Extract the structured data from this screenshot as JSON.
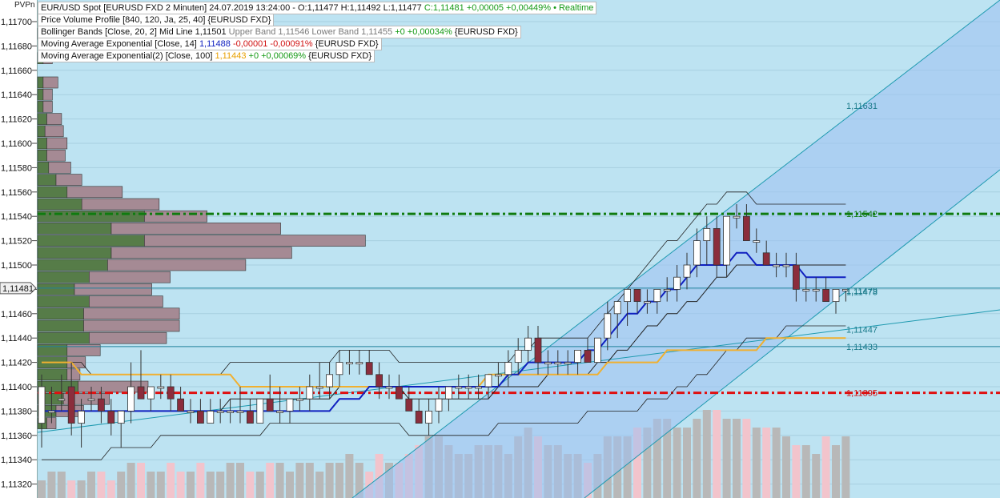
{
  "legend": {
    "symbol": {
      "title": "EUR/USD Spot [EURUSD FXD 2 Minuten] 24.07.2019 13:24:00 -",
      "ohl": "O:1,11477 H:1,11492 L:1,11477",
      "change": "C:1,11481 +0,00005 +0,00449% • Realtime"
    },
    "pvp": {
      "label": "Price Volume Profile [840, 120, Ja, 25, 40] {EURUSD FXD}"
    },
    "bb": {
      "name": "Bollinger Bands [Close, 20, 2]",
      "mid": "Mid Line 1,11501",
      "upper": "Upper Band 1,11546",
      "lower": "Lower Band 1,11455",
      "change": "+0 +0,00034%",
      "source": "{EURUSD FXD}"
    },
    "ema14": {
      "name": "Moving Average Exponential [Close, 14]",
      "value": "1,11488",
      "change": "-0,00001 -0,00091%",
      "source": "{EURUSD FXD}"
    },
    "ema100": {
      "name": "Moving Average Exponential(2) [Close, 100]",
      "value": "1,11443",
      "change": "+0 +0,00069%",
      "source": "{EURUSD FXD}"
    }
  },
  "axis": {
    "corner_label": "PVPn",
    "current_price_label": "1,11481",
    "tick_labels": [
      "1,11700",
      "1,11680",
      "1,11660",
      "1,11640",
      "1,11620",
      "1,11600",
      "1,11580",
      "1,11560",
      "1,11540",
      "1,11520",
      "1,11500",
      "1,11480",
      "1,11460",
      "1,11440",
      "1,11420",
      "1,11400",
      "1,11380",
      "1,11360",
      "1,11340",
      "1,11320"
    ]
  },
  "chart_data": {
    "type": "candlestick",
    "instrument": "EUR/USD Spot",
    "timeframe": "2 Minuten",
    "ylim": [
      1.1131,
      1.1171
    ],
    "yticks": [
      1.117,
      1.1168,
      1.1166,
      1.1164,
      1.1162,
      1.116,
      1.1158,
      1.1156,
      1.1154,
      1.1152,
      1.115,
      1.1148,
      1.1146,
      1.1144,
      1.1142,
      1.114,
      1.1138,
      1.1136,
      1.1134,
      1.1132
    ],
    "current_price": 1.11481,
    "candles": [
      {
        "o": 1.1137,
        "h": 1.1141,
        "l": 1.1135,
        "c": 1.114
      },
      {
        "o": 1.1138,
        "h": 1.114,
        "l": 1.1137,
        "c": 1.1138
      },
      {
        "o": 1.1139,
        "h": 1.1141,
        "l": 1.1138,
        "c": 1.1139
      },
      {
        "o": 1.114,
        "h": 1.1142,
        "l": 1.1136,
        "c": 1.1137
      },
      {
        "o": 1.1137,
        "h": 1.1139,
        "l": 1.1135,
        "c": 1.1138
      },
      {
        "o": 1.1139,
        "h": 1.114,
        "l": 1.1138,
        "c": 1.1139
      },
      {
        "o": 1.1139,
        "h": 1.114,
        "l": 1.1137,
        "c": 1.1138
      },
      {
        "o": 1.1138,
        "h": 1.1139,
        "l": 1.1136,
        "c": 1.1137
      },
      {
        "o": 1.1137,
        "h": 1.1138,
        "l": 1.1135,
        "c": 1.1138
      },
      {
        "o": 1.1138,
        "h": 1.1142,
        "l": 1.1137,
        "c": 1.114
      },
      {
        "o": 1.114,
        "h": 1.1143,
        "l": 1.1139,
        "c": 1.1139
      },
      {
        "o": 1.1139,
        "h": 1.114,
        "l": 1.1138,
        "c": 1.114
      },
      {
        "o": 1.114,
        "h": 1.1141,
        "l": 1.1139,
        "c": 1.114
      },
      {
        "o": 1.114,
        "h": 1.1141,
        "l": 1.1138,
        "c": 1.1139
      },
      {
        "o": 1.1139,
        "h": 1.114,
        "l": 1.1138,
        "c": 1.1138
      },
      {
        "o": 1.1138,
        "h": 1.1139,
        "l": 1.1137,
        "c": 1.1138
      },
      {
        "o": 1.1138,
        "h": 1.1139,
        "l": 1.1137,
        "c": 1.1137
      },
      {
        "o": 1.1137,
        "h": 1.1139,
        "l": 1.1137,
        "c": 1.1138
      },
      {
        "o": 1.1138,
        "h": 1.1139,
        "l": 1.1137,
        "c": 1.1138
      },
      {
        "o": 1.1138,
        "h": 1.1139,
        "l": 1.1137,
        "c": 1.1138
      },
      {
        "o": 1.1138,
        "h": 1.114,
        "l": 1.1137,
        "c": 1.1138
      },
      {
        "o": 1.1138,
        "h": 1.1139,
        "l": 1.1137,
        "c": 1.1137
      },
      {
        "o": 1.1137,
        "h": 1.1139,
        "l": 1.1137,
        "c": 1.1139
      },
      {
        "o": 1.1139,
        "h": 1.1141,
        "l": 1.1138,
        "c": 1.1138
      },
      {
        "o": 1.1138,
        "h": 1.114,
        "l": 1.1137,
        "c": 1.1138
      },
      {
        "o": 1.1138,
        "h": 1.1139,
        "l": 1.1137,
        "c": 1.1139
      },
      {
        "o": 1.1139,
        "h": 1.114,
        "l": 1.1138,
        "c": 1.1139
      },
      {
        "o": 1.1139,
        "h": 1.1141,
        "l": 1.1138,
        "c": 1.114
      },
      {
        "o": 1.114,
        "h": 1.1142,
        "l": 1.1139,
        "c": 1.114
      },
      {
        "o": 1.114,
        "h": 1.1142,
        "l": 1.1139,
        "c": 1.1141
      },
      {
        "o": 1.1141,
        "h": 1.1143,
        "l": 1.114,
        "c": 1.1142
      },
      {
        "o": 1.1142,
        "h": 1.1143,
        "l": 1.1141,
        "c": 1.1142
      },
      {
        "o": 1.1142,
        "h": 1.1143,
        "l": 1.1141,
        "c": 1.1142
      },
      {
        "o": 1.1142,
        "h": 1.1143,
        "l": 1.1141,
        "c": 1.1141
      },
      {
        "o": 1.1141,
        "h": 1.1142,
        "l": 1.1139,
        "c": 1.114
      },
      {
        "o": 1.114,
        "h": 1.1141,
        "l": 1.1139,
        "c": 1.114
      },
      {
        "o": 1.114,
        "h": 1.1141,
        "l": 1.1139,
        "c": 1.1139
      },
      {
        "o": 1.1139,
        "h": 1.114,
        "l": 1.1138,
        "c": 1.1138
      },
      {
        "o": 1.1138,
        "h": 1.1139,
        "l": 1.1137,
        "c": 1.1137
      },
      {
        "o": 1.1137,
        "h": 1.1139,
        "l": 1.1136,
        "c": 1.1138
      },
      {
        "o": 1.1138,
        "h": 1.114,
        "l": 1.1137,
        "c": 1.1139
      },
      {
        "o": 1.1139,
        "h": 1.114,
        "l": 1.1138,
        "c": 1.114
      },
      {
        "o": 1.114,
        "h": 1.1141,
        "l": 1.1139,
        "c": 1.114
      },
      {
        "o": 1.114,
        "h": 1.1141,
        "l": 1.1139,
        "c": 1.114
      },
      {
        "o": 1.114,
        "h": 1.1141,
        "l": 1.1139,
        "c": 1.114
      },
      {
        "o": 1.114,
        "h": 1.1141,
        "l": 1.1139,
        "c": 1.1141
      },
      {
        "o": 1.1141,
        "h": 1.1142,
        "l": 1.114,
        "c": 1.1141
      },
      {
        "o": 1.1141,
        "h": 1.1143,
        "l": 1.114,
        "c": 1.1142
      },
      {
        "o": 1.1142,
        "h": 1.1144,
        "l": 1.1141,
        "c": 1.1143
      },
      {
        "o": 1.1143,
        "h": 1.1145,
        "l": 1.1142,
        "c": 1.1144
      },
      {
        "o": 1.1144,
        "h": 1.1145,
        "l": 1.1141,
        "c": 1.1142
      },
      {
        "o": 1.1142,
        "h": 1.1143,
        "l": 1.1141,
        "c": 1.1142
      },
      {
        "o": 1.1142,
        "h": 1.1143,
        "l": 1.1141,
        "c": 1.1142
      },
      {
        "o": 1.1142,
        "h": 1.1143,
        "l": 1.1141,
        "c": 1.1142
      },
      {
        "o": 1.1142,
        "h": 1.1143,
        "l": 1.1141,
        "c": 1.1143
      },
      {
        "o": 1.1143,
        "h": 1.1144,
        "l": 1.1142,
        "c": 1.1142
      },
      {
        "o": 1.1142,
        "h": 1.1144,
        "l": 1.1142,
        "c": 1.1144
      },
      {
        "o": 1.1144,
        "h": 1.1147,
        "l": 1.1143,
        "c": 1.1146
      },
      {
        "o": 1.1146,
        "h": 1.1147,
        "l": 1.1144,
        "c": 1.1147
      },
      {
        "o": 1.1147,
        "h": 1.1148,
        "l": 1.1145,
        "c": 1.1148
      },
      {
        "o": 1.1148,
        "h": 1.1148,
        "l": 1.1146,
        "c": 1.1147
      },
      {
        "o": 1.1147,
        "h": 1.1148,
        "l": 1.1146,
        "c": 1.1147
      },
      {
        "o": 1.1147,
        "h": 1.1148,
        "l": 1.1146,
        "c": 1.1148
      },
      {
        "o": 1.1148,
        "h": 1.1149,
        "l": 1.1147,
        "c": 1.1148
      },
      {
        "o": 1.1148,
        "h": 1.115,
        "l": 1.1147,
        "c": 1.1149
      },
      {
        "o": 1.1149,
        "h": 1.1151,
        "l": 1.1148,
        "c": 1.115
      },
      {
        "o": 1.115,
        "h": 1.1153,
        "l": 1.1149,
        "c": 1.1152
      },
      {
        "o": 1.1152,
        "h": 1.1154,
        "l": 1.115,
        "c": 1.1153
      },
      {
        "o": 1.1153,
        "h": 1.1154,
        "l": 1.1149,
        "c": 1.115
      },
      {
        "o": 1.115,
        "h": 1.1154,
        "l": 1.1149,
        "c": 1.1154
      },
      {
        "o": 1.1154,
        "h": 1.1155,
        "l": 1.1153,
        "c": 1.1154
      },
      {
        "o": 1.1154,
        "h": 1.1155,
        "l": 1.1152,
        "c": 1.1152
      },
      {
        "o": 1.1152,
        "h": 1.1153,
        "l": 1.1151,
        "c": 1.1152
      },
      {
        "o": 1.1151,
        "h": 1.1152,
        "l": 1.115,
        "c": 1.115
      },
      {
        "o": 1.115,
        "h": 1.1151,
        "l": 1.1149,
        "c": 1.115
      },
      {
        "o": 1.115,
        "h": 1.1151,
        "l": 1.1149,
        "c": 1.115
      },
      {
        "o": 1.115,
        "h": 1.1151,
        "l": 1.1147,
        "c": 1.1148
      },
      {
        "o": 1.1148,
        "h": 1.1149,
        "l": 1.1147,
        "c": 1.1148
      },
      {
        "o": 1.1148,
        "h": 1.1149,
        "l": 1.1147,
        "c": 1.1148
      },
      {
        "o": 1.1148,
        "h": 1.1149,
        "l": 1.1147,
        "c": 1.1147
      },
      {
        "o": 1.1147,
        "h": 1.1148,
        "l": 1.1146,
        "c": 1.1148
      },
      {
        "o": 1.1148,
        "h": 1.1148,
        "l": 1.1147,
        "c": 1.1148
      }
    ],
    "ema14": [
      1.1138,
      1.1138,
      1.1138,
      1.1138,
      1.1138,
      1.1138,
      1.1138,
      1.1138,
      1.1138,
      1.1138,
      1.1138,
      1.1138,
      1.1138,
      1.1138,
      1.1138,
      1.1138,
      1.1138,
      1.1138,
      1.1138,
      1.1138,
      1.1138,
      1.1138,
      1.1138,
      1.1138,
      1.1138,
      1.1138,
      1.1138,
      1.1138,
      1.1138,
      1.1138,
      1.1139,
      1.1139,
      1.1139,
      1.114,
      1.114,
      1.114,
      1.114,
      1.114,
      1.114,
      1.114,
      1.114,
      1.114,
      1.114,
      1.114,
      1.114,
      1.114,
      1.114,
      1.1141,
      1.1141,
      1.1142,
      1.1142,
      1.1142,
      1.1142,
      1.1142,
      1.1142,
      1.1143,
      1.1143,
      1.1144,
      1.1145,
      1.1146,
      1.1146,
      1.1147,
      1.1147,
      1.1148,
      1.1148,
      1.1149,
      1.115,
      1.115,
      1.115,
      1.115,
      1.1151,
      1.1151,
      1.115,
      1.115,
      1.115,
      1.115,
      1.115,
      1.1149,
      1.1149,
      1.1149,
      1.1149,
      1.1149
    ],
    "ema100": [
      1.1142,
      1.1142,
      1.1142,
      1.1142,
      1.1141,
      1.1141,
      1.1141,
      1.1141,
      1.1141,
      1.1141,
      1.1141,
      1.1141,
      1.1141,
      1.1141,
      1.1141,
      1.1141,
      1.1141,
      1.1141,
      1.1141,
      1.1141,
      1.114,
      1.114,
      1.114,
      1.114,
      1.114,
      1.114,
      1.114,
      1.114,
      1.114,
      1.114,
      1.114,
      1.114,
      1.114,
      1.114,
      1.114,
      1.114,
      1.114,
      1.114,
      1.114,
      1.114,
      1.114,
      1.114,
      1.114,
      1.114,
      1.114,
      1.1141,
      1.1141,
      1.1141,
      1.1141,
      1.1141,
      1.1141,
      1.1141,
      1.1141,
      1.1141,
      1.1141,
      1.1141,
      1.1141,
      1.1142,
      1.1142,
      1.1142,
      1.1142,
      1.1142,
      1.1142,
      1.1143,
      1.1143,
      1.1143,
      1.1143,
      1.1143,
      1.1143,
      1.1143,
      1.1143,
      1.1143,
      1.1143,
      1.1144,
      1.1144,
      1.1144,
      1.1144,
      1.1144,
      1.1144,
      1.1144,
      1.1144,
      1.1144
    ],
    "bollinger_upper": [
      1.1142,
      1.1142,
      1.1142,
      1.1142,
      1.1142,
      1.1141,
      1.1141,
      1.1141,
      1.1141,
      1.1141,
      1.1141,
      1.1141,
      1.1141,
      1.1141,
      1.1141,
      1.1141,
      1.1141,
      1.1141,
      1.1141,
      1.1142,
      1.1142,
      1.1142,
      1.1142,
      1.1142,
      1.1142,
      1.1142,
      1.1142,
      1.1142,
      1.1142,
      1.1142,
      1.1143,
      1.1143,
      1.1143,
      1.1143,
      1.1143,
      1.1143,
      1.1142,
      1.1142,
      1.1142,
      1.1142,
      1.1142,
      1.1142,
      1.1142,
      1.1142,
      1.1142,
      1.1142,
      1.1142,
      1.1142,
      1.1143,
      1.1143,
      1.1144,
      1.1144,
      1.1144,
      1.1144,
      1.1144,
      1.1144,
      1.1145,
      1.1146,
      1.1147,
      1.1148,
      1.1149,
      1.115,
      1.1151,
      1.1152,
      1.1152,
      1.1153,
      1.1154,
      1.1155,
      1.1155,
      1.1156,
      1.1156,
      1.1156,
      1.1155,
      1.1155,
      1.1155,
      1.1155,
      1.1155,
      1.1155,
      1.1155,
      1.1155,
      1.1155,
      1.1155
    ],
    "bollinger_lower": [
      1.1134,
      1.1134,
      1.1134,
      1.1134,
      1.1134,
      1.1134,
      1.1134,
      1.1135,
      1.1135,
      1.1135,
      1.1135,
      1.1135,
      1.1136,
      1.1136,
      1.1136,
      1.1136,
      1.1136,
      1.1136,
      1.1136,
      1.1136,
      1.1136,
      1.1136,
      1.1136,
      1.1137,
      1.1137,
      1.1137,
      1.1137,
      1.1137,
      1.1137,
      1.1137,
      1.1137,
      1.1137,
      1.1137,
      1.1137,
      1.1137,
      1.1137,
      1.1137,
      1.1136,
      1.1136,
      1.1136,
      1.1136,
      1.1136,
      1.1136,
      1.1136,
      1.1136,
      1.1136,
      1.1137,
      1.1137,
      1.1137,
      1.1137,
      1.1137,
      1.1137,
      1.1137,
      1.1137,
      1.1137,
      1.1138,
      1.1138,
      1.1138,
      1.1138,
      1.1138,
      1.1138,
      1.1139,
      1.1139,
      1.1139,
      1.114,
      1.114,
      1.1141,
      1.1141,
      1.1142,
      1.1143,
      1.1143,
      1.1144,
      1.1144,
      1.1144,
      1.1144,
      1.1145,
      1.1145,
      1.1145,
      1.1145,
      1.1145,
      1.1145,
      1.1145
    ],
    "bollinger_mid": [
      1.1138,
      1.1138,
      1.1138,
      1.1138,
      1.1138,
      1.1138,
      1.1138,
      1.1138,
      1.1138,
      1.1138,
      1.1138,
      1.1138,
      1.1138,
      1.1138,
      1.1138,
      1.1138,
      1.1138,
      1.1138,
      1.1138,
      1.1139,
      1.1139,
      1.1139,
      1.1139,
      1.1139,
      1.1139,
      1.1139,
      1.1139,
      1.1139,
      1.1139,
      1.1139,
      1.114,
      1.114,
      1.114,
      1.114,
      1.114,
      1.114,
      1.114,
      1.1139,
      1.1139,
      1.1139,
      1.1139,
      1.1139,
      1.1139,
      1.1139,
      1.1139,
      1.1139,
      1.114,
      1.114,
      1.114,
      1.114,
      1.114,
      1.1141,
      1.1141,
      1.1141,
      1.1141,
      1.1141,
      1.1142,
      1.1142,
      1.1143,
      1.1143,
      1.1144,
      1.1145,
      1.1145,
      1.1146,
      1.1146,
      1.1147,
      1.1147,
      1.1148,
      1.1149,
      1.1149,
      1.115,
      1.115,
      1.115,
      1.115,
      1.115,
      1.115,
      1.115,
      1.115,
      1.115,
      1.115,
      1.115,
      1.115
    ],
    "volume_profile": [
      {
        "price": 1.1169,
        "up": 2,
        "down": 6
      },
      {
        "price": 1.1167,
        "up": 3,
        "down": 5
      },
      {
        "price": 1.1165,
        "up": 3,
        "down": 8
      },
      {
        "price": 1.1164,
        "up": 3,
        "down": 5
      },
      {
        "price": 1.1163,
        "up": 3,
        "down": 5
      },
      {
        "price": 1.1162,
        "up": 5,
        "down": 8
      },
      {
        "price": 1.1161,
        "up": 4,
        "down": 10
      },
      {
        "price": 1.116,
        "up": 5,
        "down": 11
      },
      {
        "price": 1.1159,
        "up": 5,
        "down": 10
      },
      {
        "price": 1.1158,
        "up": 6,
        "down": 12
      },
      {
        "price": 1.1157,
        "up": 10,
        "down": 14
      },
      {
        "price": 1.1156,
        "up": 16,
        "down": 30
      },
      {
        "price": 1.1155,
        "up": 24,
        "down": 42
      },
      {
        "price": 1.1154,
        "up": 58,
        "down": 34
      },
      {
        "price": 1.1153,
        "up": 40,
        "down": 92
      },
      {
        "price": 1.1152,
        "up": 58,
        "down": 120
      },
      {
        "price": 1.1151,
        "up": 40,
        "down": 98
      },
      {
        "price": 1.115,
        "up": 38,
        "down": 75
      },
      {
        "price": 1.1149,
        "up": 28,
        "down": 44
      },
      {
        "price": 1.1148,
        "up": 20,
        "down": 42
      },
      {
        "price": 1.1147,
        "up": 28,
        "down": 40
      },
      {
        "price": 1.1146,
        "up": 25,
        "down": 52
      },
      {
        "price": 1.1145,
        "up": 25,
        "down": 52
      },
      {
        "price": 1.1144,
        "up": 28,
        "down": 42
      },
      {
        "price": 1.1143,
        "up": 16,
        "down": 18
      },
      {
        "price": 1.1142,
        "up": 16,
        "down": 10
      },
      {
        "price": 1.1141,
        "up": 16,
        "down": 7
      },
      {
        "price": 1.114,
        "up": 22,
        "down": 38
      },
      {
        "price": 1.1139,
        "up": 14,
        "down": 25
      },
      {
        "price": 1.1138,
        "up": 10,
        "down": 15
      },
      {
        "price": 1.1137,
        "up": 5,
        "down": 5
      }
    ],
    "volume": [
      2,
      3,
      3,
      2,
      2,
      3,
      3,
      2,
      3,
      4,
      4,
      3,
      3,
      4,
      3,
      3,
      4,
      3,
      3,
      4,
      4,
      3,
      3,
      4,
      4,
      3,
      4,
      4,
      3,
      4,
      4,
      5,
      4,
      3,
      5,
      4,
      4,
      5,
      6,
      7,
      7,
      6,
      5,
      5,
      6,
      6,
      6,
      5,
      7,
      8,
      7,
      6,
      6,
      5,
      5,
      4,
      5,
      7,
      7,
      7,
      8,
      8,
      9,
      9,
      8,
      8,
      9,
      10,
      10,
      9,
      9,
      9,
      8,
      8,
      8,
      7,
      6,
      6,
      5,
      7,
      6,
      7
    ],
    "levels": [
      {
        "label": "1,11631",
        "price": 1.11631
      },
      {
        "label": "1,11542",
        "price": 1.11542
      },
      {
        "label": "1,11479",
        "price": 1.11479
      },
      {
        "label": "1,11478",
        "price": 1.11478
      },
      {
        "label": "1,11447",
        "price": 1.11447
      },
      {
        "label": "1,11433",
        "price": 1.11433
      },
      {
        "label": "1,11395",
        "price": 1.11395
      }
    ]
  },
  "colors": {
    "background": "#bde3f2",
    "channel_fill": "#9ec1f2",
    "bull_candle": "#ffffff",
    "bear_candle": "#8b2d3c",
    "ema14": "#1020c0",
    "ema100": "#f0b030",
    "bollinger": "#222222",
    "pvp_up": "#567c48",
    "pvp_down": "#a58a94",
    "resistance_line": "#0f7b0f",
    "support_line": "#e01010",
    "volume_bull": "#b8b8b8",
    "volume_bear": "#f2c4cc",
    "channel_line": "#1f9ab0"
  }
}
